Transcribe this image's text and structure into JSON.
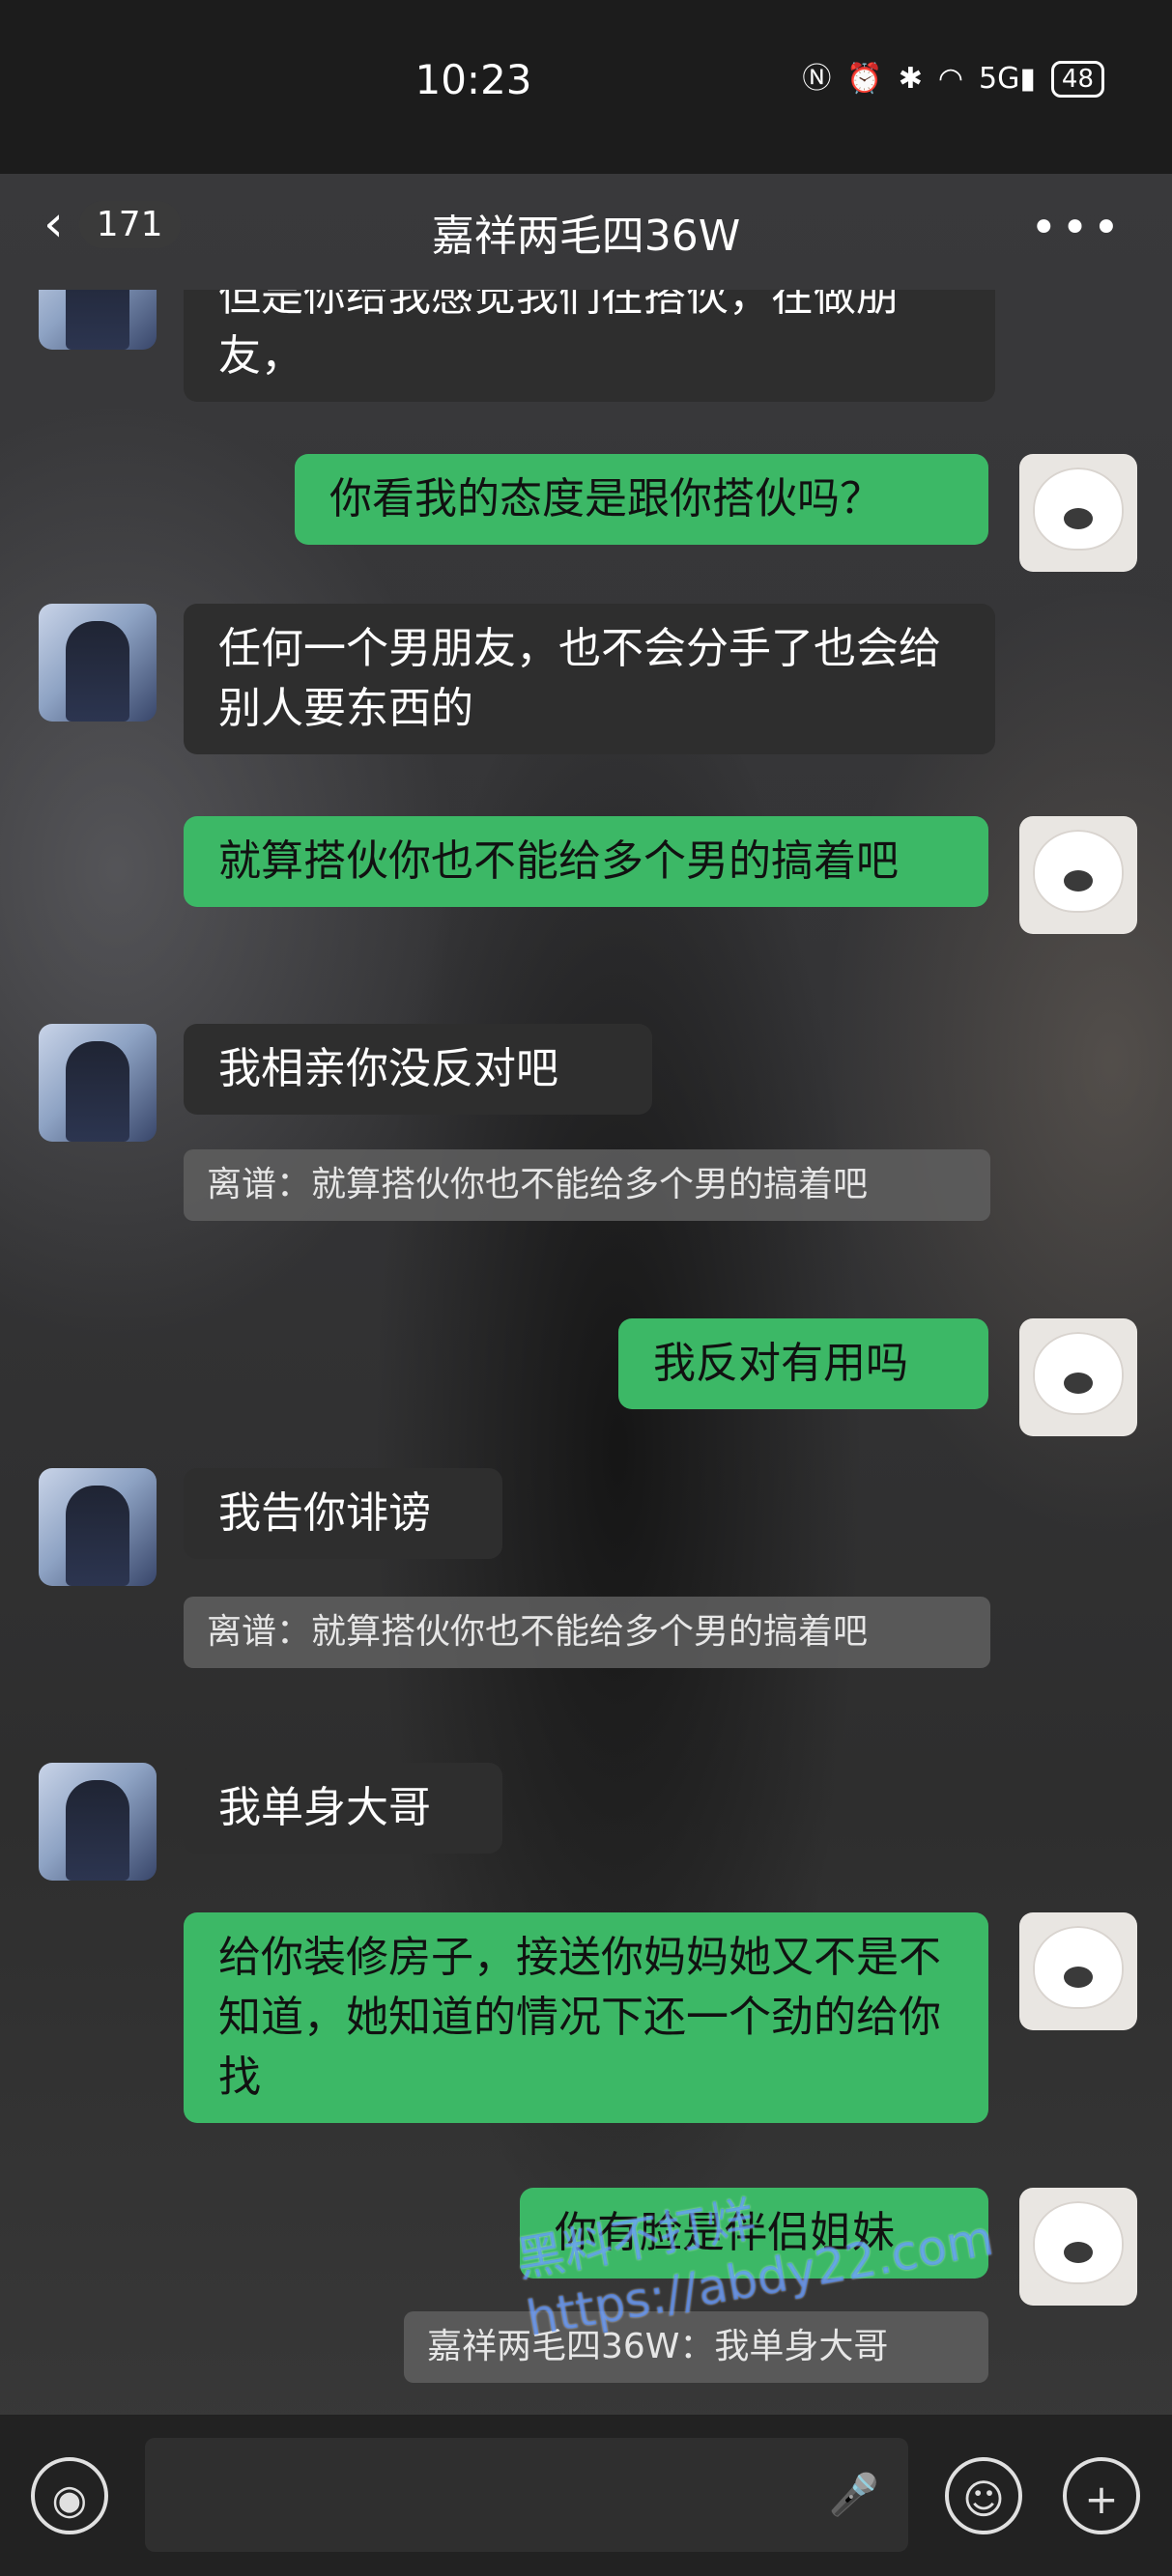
{
  "status_bar": {
    "time": "10:23",
    "icons": [
      "nfc-icon",
      "alarm-icon",
      "bluetooth-icon",
      "wifi-icon",
      "5g-signal-icon"
    ],
    "signal_label": "5G",
    "battery": "48"
  },
  "header": {
    "back_count": "171",
    "title": "嘉祥两毛四36W",
    "more_label": "•••"
  },
  "messages": [
    {
      "side": "left",
      "text": "但是你给我感觉我们在搭伙，在做朋友，",
      "quote": ""
    },
    {
      "side": "right",
      "text": "你看我的态度是跟你搭伙吗？",
      "quote": ""
    },
    {
      "side": "left",
      "text": "任何一个男朋友，也不会分手了也会给别人要东西的",
      "quote": ""
    },
    {
      "side": "right",
      "text": "就算搭伙你也不能给多个男的搞着吧",
      "quote": ""
    },
    {
      "side": "left",
      "text": "我相亲你没反对吧",
      "quote": "离谱：就算搭伙你也不能给多个男的搞着吧"
    },
    {
      "side": "right",
      "text": "我反对有用吗",
      "quote": ""
    },
    {
      "side": "left",
      "text": "我告你诽谤",
      "quote": "离谱：就算搭伙你也不能给多个男的搞着吧"
    },
    {
      "side": "left",
      "text": "我单身大哥",
      "quote": ""
    },
    {
      "side": "right",
      "text": "给你装修房子，接送你妈妈她又不是不知道，她知道的情况下还一个劲的给你找",
      "quote": ""
    },
    {
      "side": "right",
      "text": "你有脸是伴侣姐妹",
      "quote": "嘉祥两毛四36W：我单身大哥"
    }
  ],
  "watermark": {
    "line1": "黑料不打烊",
    "line2": "https://abdy22.com"
  },
  "input_bar": {
    "voice_icon": "voice-icon",
    "mic_icon": "mic-icon",
    "emoji_icon": "emoji-icon",
    "plus_icon": "plus-icon",
    "voice_glyph": "◉",
    "mic_glyph": "🎤",
    "emoji_glyph": "☺",
    "plus_glyph": "+"
  },
  "colors": {
    "bubble_self": "#3cb866",
    "bubble_other": "#2e2e2e",
    "quote_bg": "#5f5f5f"
  }
}
